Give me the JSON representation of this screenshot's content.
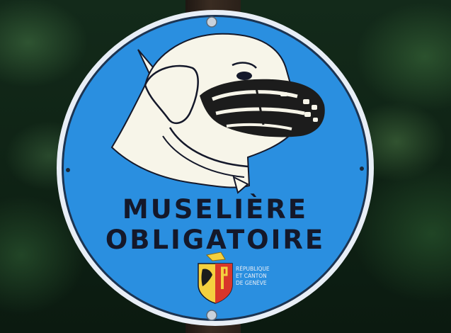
{
  "sign": {
    "line1": "MUSELIÈRE",
    "line2": "OBLIGATOIRE",
    "emblem_line1": "RÉPUBLIQUE",
    "emblem_line2": "ET CANTON",
    "emblem_line3": "DE GENÈVE",
    "colors": {
      "sign_blue": "#2a8fe0",
      "rim": "#e8eef6",
      "text": "#14182a",
      "dog": "#f7f5e9",
      "muzzle": "#1c1c1c"
    }
  },
  "icons": {
    "dog": "muzzled-dog-icon",
    "emblem": "geneva-coat-of-arms-icon"
  }
}
